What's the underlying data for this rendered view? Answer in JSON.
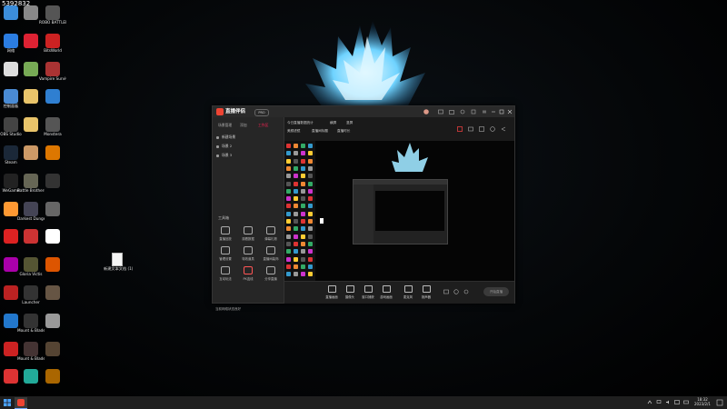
{
  "overlay": {
    "stream_id": "5392832"
  },
  "desktop_icons": [
    {
      "label": "",
      "color": "#3c8dd9"
    },
    {
      "label": "",
      "color": "#888"
    },
    {
      "label": "ROBO BATTLER",
      "color": "#555"
    },
    {
      "label": "网络",
      "color": "#2b7de1"
    },
    {
      "label": "",
      "color": "#d23"
    },
    {
      "label": "BitsWorld",
      "color": "#c22"
    },
    {
      "label": "",
      "color": "#ddd"
    },
    {
      "label": "",
      "color": "#7a5"
    },
    {
      "label": "Vampire Survivors",
      "color": "#a33"
    },
    {
      "label": "控制面板",
      "color": "#4a8bd4"
    },
    {
      "label": "",
      "color": "#e9c46a"
    },
    {
      "label": "",
      "color": "#2f7fd1"
    },
    {
      "label": "OBS Studio",
      "color": "#444"
    },
    {
      "label": "",
      "color": "#e9c46a"
    },
    {
      "label": "Monstera",
      "color": "#555"
    },
    {
      "label": "Steam",
      "color": "#1b2838"
    },
    {
      "label": "",
      "color": "#c96"
    },
    {
      "label": "",
      "color": "#d70"
    },
    {
      "label": "WeGame",
      "color": "#222"
    },
    {
      "label": "Battle Brothers",
      "color": "#665"
    },
    {
      "label": "",
      "color": "#333"
    },
    {
      "label": "",
      "color": "#f93"
    },
    {
      "label": "Darkest Dungeon",
      "color": "#445"
    },
    {
      "label": "",
      "color": "#666"
    },
    {
      "label": "",
      "color": "#d22"
    },
    {
      "label": "",
      "color": "#c33"
    },
    {
      "label": "",
      "color": "#fff"
    },
    {
      "label": "",
      "color": "#a0a"
    },
    {
      "label": "Gloria Victis",
      "color": "#553"
    },
    {
      "label": "",
      "color": "#d50"
    },
    {
      "label": "",
      "color": "#b22"
    },
    {
      "label": "Launcher",
      "color": "#333"
    },
    {
      "label": "",
      "color": "#654"
    },
    {
      "label": "",
      "color": "#27c"
    },
    {
      "label": "Mount & Blade II",
      "color": "#333"
    },
    {
      "label": "",
      "color": "#999"
    },
    {
      "label": "",
      "color": "#c22"
    },
    {
      "label": "Mount & Blade",
      "color": "#433"
    },
    {
      "label": "",
      "color": "#543"
    },
    {
      "label": "",
      "color": "#d33"
    },
    {
      "label": "",
      "color": "#2a9"
    },
    {
      "label": "",
      "color": "#a60"
    }
  ],
  "desktop_file": {
    "label": "新建文本文档 (1)"
  },
  "app": {
    "title": "直播伴侣",
    "badge": "PRO",
    "left_tabs": [
      "场景管理",
      "添加",
      "工作区"
    ],
    "scenes": [
      "新建场景",
      "场景 2",
      "场景 3"
    ],
    "tools_title": "工具箱",
    "tools": [
      "直播回放",
      "观看数据",
      "弹幕礼物",
      "管理设置",
      "特效道具",
      "直播间装饰",
      "互动玩法",
      "PK连线",
      "分享直播"
    ],
    "status_text": "当前网络状态良好",
    "main_tabs": [
      "今日直播数据统计",
      "横屏",
      "竖屏",
      "美颜滤镜",
      "直播间标题",
      "直播时长"
    ],
    "bottom_tools": [
      "直播画面",
      "摄像头",
      "窗口捕获",
      "游戏画面",
      "麦克风",
      "扬声器"
    ],
    "live_button": "开始直播"
  },
  "taskbar": {
    "time": "18:32",
    "date": "2023/2/1"
  }
}
